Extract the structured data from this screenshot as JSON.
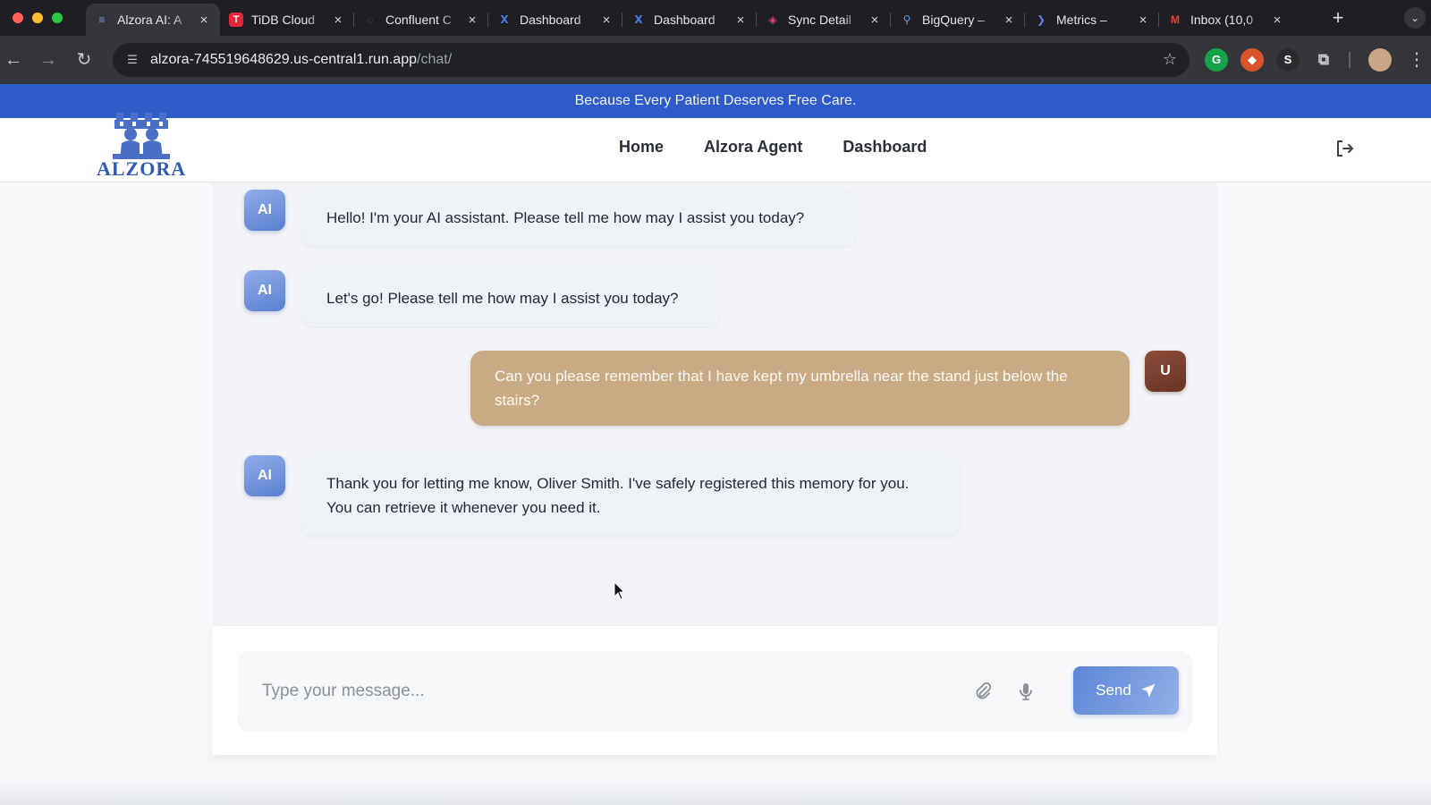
{
  "browser": {
    "tabs": [
      {
        "label": "Alzora AI: A",
        "active": true,
        "favicon": "alzora-favicon",
        "close": "×"
      },
      {
        "label": "TiDB Cloud",
        "favicon": "tidb-icon",
        "close": "×"
      },
      {
        "label": "Confluent C",
        "favicon": "confluent-icon",
        "close": "×"
      },
      {
        "label": "Dashboard",
        "favicon": "dashboard-icon",
        "close": "×"
      },
      {
        "label": "Dashboard",
        "favicon": "dashboard-icon",
        "close": "×"
      },
      {
        "label": "Sync Detail",
        "favicon": "sync-icon",
        "close": "×"
      },
      {
        "label": "BigQuery –",
        "favicon": "bigquery-icon",
        "close": "×"
      },
      {
        "label": "Metrics – ",
        "favicon": "metrics-icon",
        "close": "×"
      },
      {
        "label": "Inbox (10,0",
        "favicon": "gmail-icon",
        "close": "×"
      }
    ],
    "url_host": "alzora-745519648629.us-central1.run.app",
    "url_path": "/chat/"
  },
  "banner": {
    "text": "Because Every Patient Deserves Free Care."
  },
  "header": {
    "logo_text": "ALZORA",
    "nav": [
      "Home",
      "Alzora Agent",
      "Dashboard"
    ]
  },
  "chat": {
    "messages": [
      {
        "role": "ai",
        "avatar": "AI",
        "text": "Hello! I'm your AI assistant. Please tell me how may I assist you today?"
      },
      {
        "role": "ai",
        "avatar": "AI",
        "text": "Let's go! Please tell me how may I assist you today?"
      },
      {
        "role": "user",
        "avatar": "U",
        "text": "Can you please remember that I have kept my umbrella near the stand just below the stairs?"
      },
      {
        "role": "ai",
        "avatar": "AI",
        "text": "Thank you for letting me know, Oliver Smith. I've safely registered this memory for you. You can retrieve it whenever you need it."
      }
    ]
  },
  "composer": {
    "placeholder": "Type your message...",
    "value": "",
    "send_label": "Send"
  },
  "colors": {
    "banner": "#2d5bc8",
    "user_bubble": "#c8ab85",
    "ai_avatar": "#6f8fd8",
    "user_avatar": "#7a3f30",
    "send_button": "#7097de"
  }
}
